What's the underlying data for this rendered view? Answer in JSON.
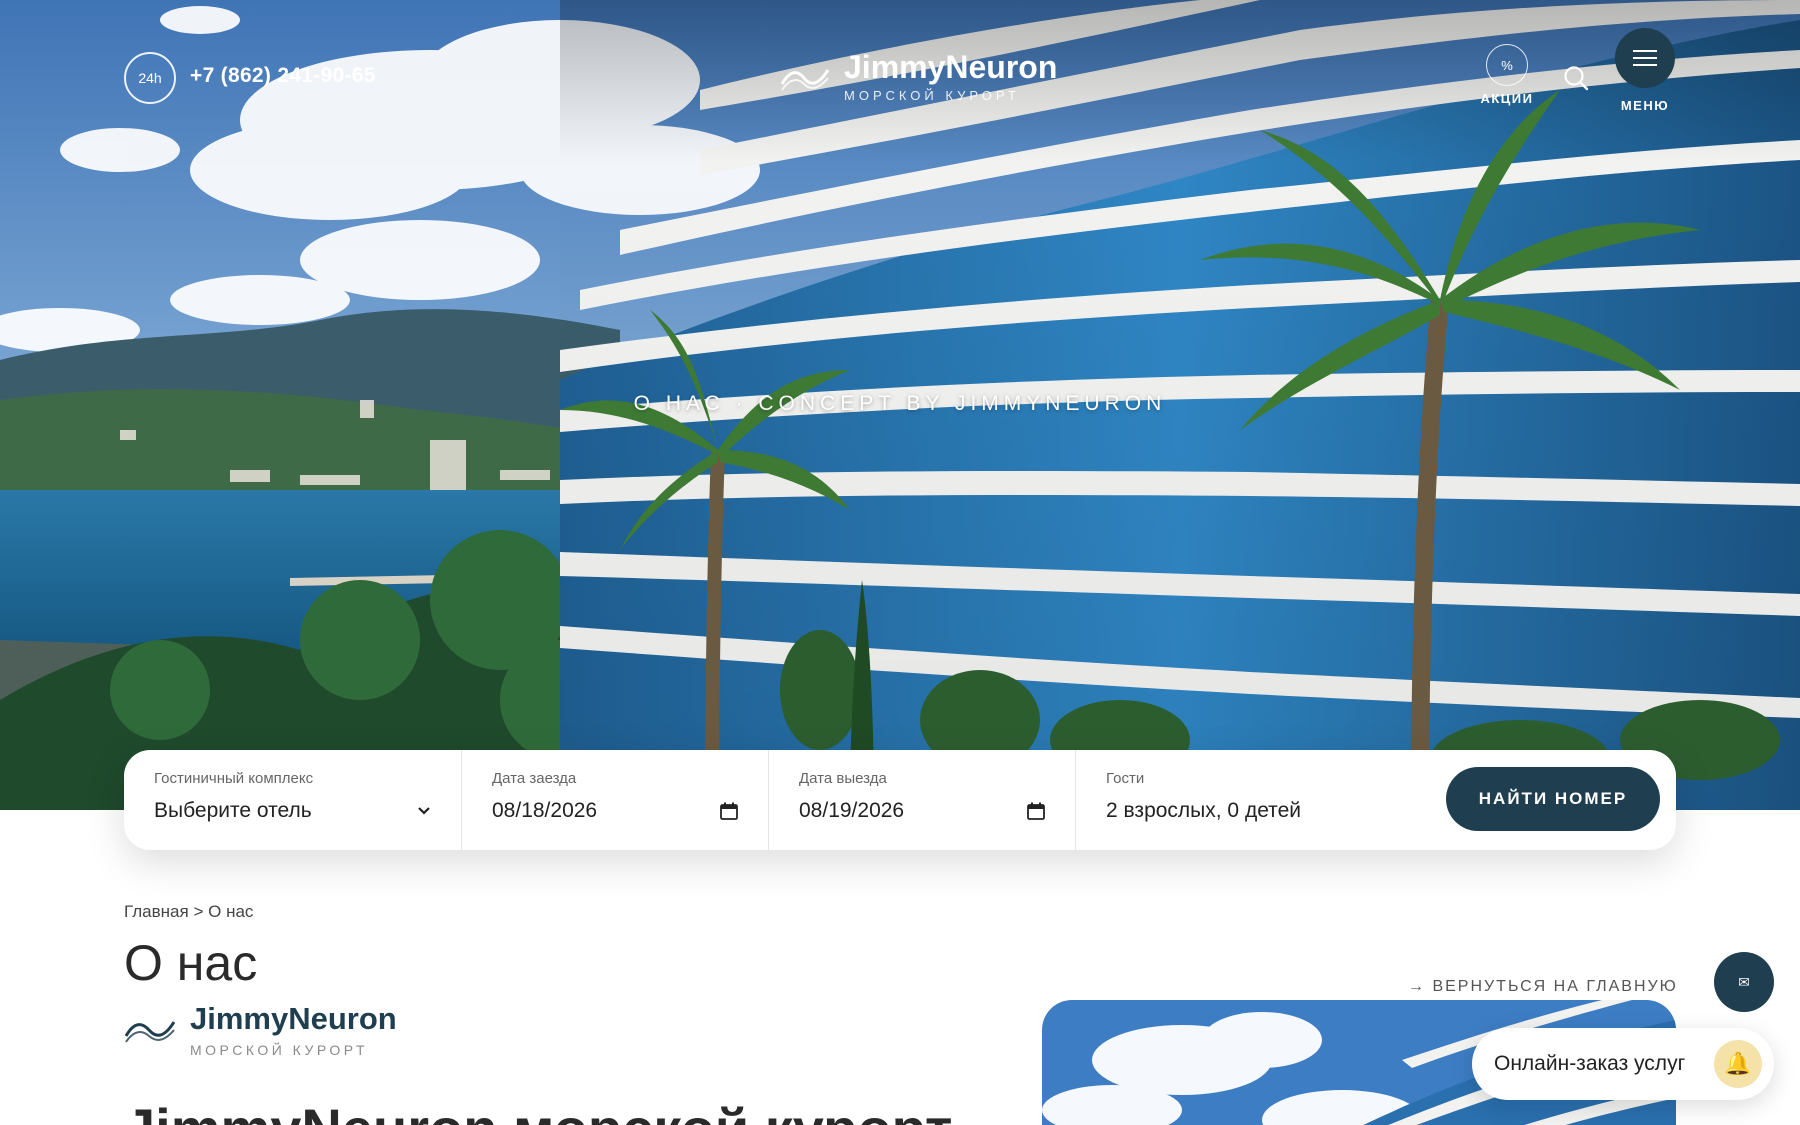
{
  "header": {
    "badge_24": "24h",
    "phone": "+7 (862) 241-90-65",
    "brand": "JimmyNeuron",
    "brand_sub": "МОРСКОЙ КУРОРТ",
    "promo_symbol": "%",
    "promo_label": "АКЦИИ",
    "menu_label": "МЕНЮ"
  },
  "hero": {
    "caption": "О НАС · CONCEPT BY JIMMYNEURON"
  },
  "booking": {
    "hotel": {
      "label": "Гостиничный комплекс",
      "value": "Выберите отель"
    },
    "checkin": {
      "label": "Дата заезда",
      "value": "08/18/2026"
    },
    "checkout": {
      "label": "Дата выезда",
      "value": "08/19/2026"
    },
    "guests": {
      "label": "Гости",
      "value": "2 взрослых, 0 детей"
    },
    "submit_label": "НАЙТИ НОМЕР"
  },
  "breadcrumb": {
    "home": "Главная",
    "separator": ">",
    "current": "О нас"
  },
  "page": {
    "title": "О нас",
    "brand": "JimmyNeuron",
    "brand_sub": "МОРСКОЙ КУРОРТ",
    "article_heading": "JimmyNeuron морской курорт",
    "back_link": "→ ВЕРНУТЬСЯ НА ГЛАВНУЮ"
  },
  "widgets": {
    "order_label": "Онлайн-заказ услуг",
    "mail_icon": "✉",
    "bell_icon": "🔔"
  },
  "colors": {
    "accent": "#1f3e50",
    "bell_bg": "#f4e2a8"
  }
}
